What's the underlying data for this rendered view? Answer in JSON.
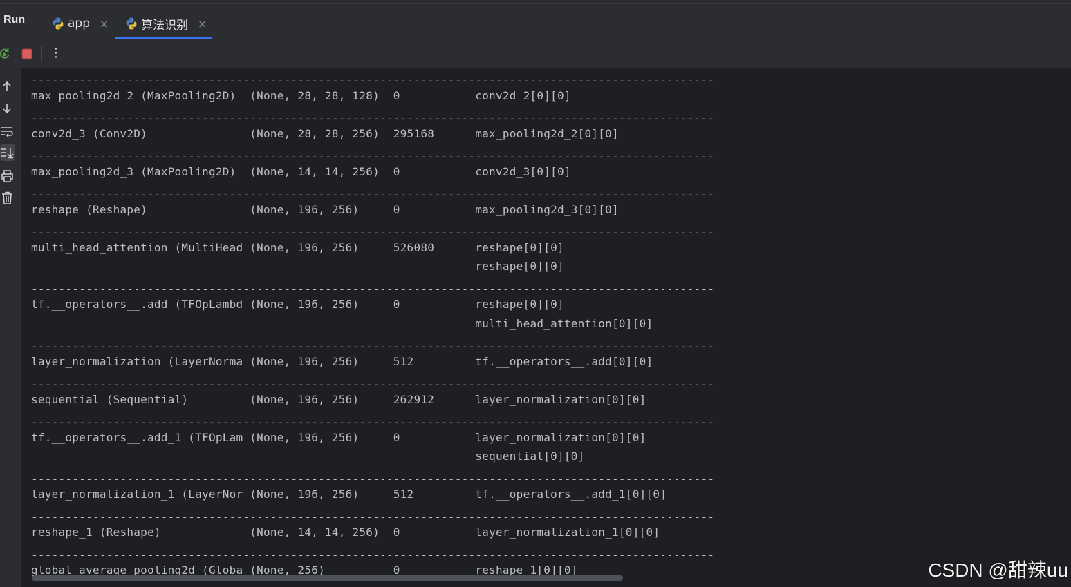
{
  "tool_window": {
    "title": "Run",
    "tabs": [
      {
        "label": "app",
        "close": "×",
        "active": false
      },
      {
        "label": "算法识别",
        "close": "×",
        "active": true
      }
    ]
  },
  "toolbar": {
    "rerun_icon": "rerun-icon",
    "stop_icon": "stop-icon",
    "more_label": "⋮"
  },
  "sidebar": {
    "icons": [
      "up-arrow-icon",
      "down-arrow-icon",
      "soft-wrap-icon",
      "scroll-to-end-icon",
      "print-icon",
      "trash-icon"
    ]
  },
  "console": {
    "lines": [
      "----------------------------------------------------------------------------------------------------",
      "max_pooling2d_2 (MaxPooling2D)  (None, 28, 28, 128)  0           conv2d_2[0][0]",
      "----------------------------------------------------------------------------------------------------",
      "conv2d_3 (Conv2D)               (None, 28, 28, 256)  295168      max_pooling2d_2[0][0]",
      "----------------------------------------------------------------------------------------------------",
      "max_pooling2d_3 (MaxPooling2D)  (None, 14, 14, 256)  0           conv2d_3[0][0]",
      "----------------------------------------------------------------------------------------------------",
      "reshape (Reshape)               (None, 196, 256)     0           max_pooling2d_3[0][0]",
      "----------------------------------------------------------------------------------------------------",
      "multi_head_attention (MultiHead (None, 196, 256)     526080      reshape[0][0]",
      "                                                                 reshape[0][0]",
      "----------------------------------------------------------------------------------------------------",
      "tf.__operators__.add (TFOpLambd (None, 196, 256)     0           reshape[0][0]",
      "                                                                 multi_head_attention[0][0]",
      "----------------------------------------------------------------------------------------------------",
      "layer_normalization (LayerNorma (None, 196, 256)     512         tf.__operators__.add[0][0]",
      "----------------------------------------------------------------------------------------------------",
      "sequential (Sequential)         (None, 196, 256)     262912      layer_normalization[0][0]",
      "----------------------------------------------------------------------------------------------------",
      "tf.__operators__.add_1 (TFOpLam (None, 196, 256)     0           layer_normalization[0][0]",
      "                                                                 sequential[0][0]",
      "----------------------------------------------------------------------------------------------------",
      "layer_normalization_1 (LayerNor (None, 196, 256)     512         tf.__operators__.add_1[0][0]",
      "----------------------------------------------------------------------------------------------------",
      "reshape_1 (Reshape)             (None, 14, 14, 256)  0           layer_normalization_1[0][0]",
      "----------------------------------------------------------------------------------------------------",
      "global_average_pooling2d (Globa (None, 256)          0           reshape_1[0][0]"
    ]
  },
  "watermark": "CSDN @甜辣uu",
  "colors": {
    "accent": "#3574f0",
    "stop": "#db5c5c",
    "text": "#bcbec4",
    "background": "#1e1f22",
    "panel": "#2b2d30"
  }
}
